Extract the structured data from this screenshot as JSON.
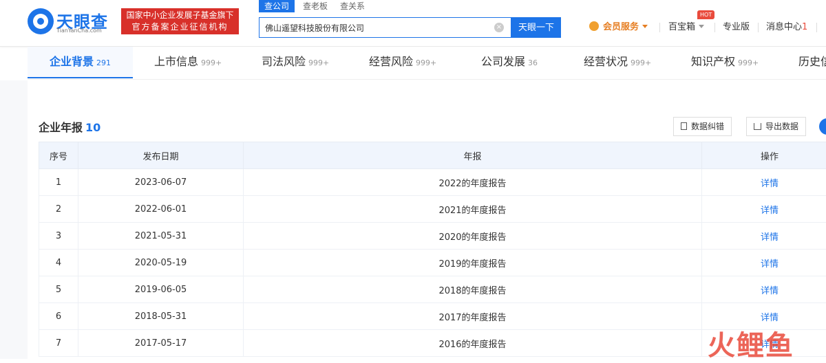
{
  "header": {
    "logo_name": "天眼查",
    "logo_sub": "TianYanCha.com",
    "badge_line1": "国家中小企业发展子基金旗下",
    "badge_line2": "官方备案企业征信机构",
    "search_tabs": [
      "查公司",
      "查老板",
      "查关系"
    ],
    "search_value": "佛山遥望科技股份有限公司",
    "search_button": "天眼一下",
    "vip_label": "会员服务",
    "hot_badge": "HOT",
    "toolbox_label": "百宝箱",
    "pro_label": "专业版",
    "message_label": "消息中心",
    "message_count": "1"
  },
  "tabs": [
    {
      "label": "企业背景",
      "count": "291"
    },
    {
      "label": "上市信息",
      "count": "999+"
    },
    {
      "label": "司法风险",
      "count": "999+"
    },
    {
      "label": "经营风险",
      "count": "999+"
    },
    {
      "label": "公司发展",
      "count": "36"
    },
    {
      "label": "经营状况",
      "count": "999+"
    },
    {
      "label": "知识产权",
      "count": "999+"
    },
    {
      "label": "历史信"
    }
  ],
  "section": {
    "title": "企业年报",
    "count": "10",
    "correct_button": "数据纠错",
    "export_button": "导出数据"
  },
  "table": {
    "headers": [
      "序号",
      "发布日期",
      "年报",
      "操作"
    ],
    "rows": [
      {
        "no": "1",
        "date": "2023-06-07",
        "report": "2022的年度报告",
        "action": "详情"
      },
      {
        "no": "2",
        "date": "2022-06-01",
        "report": "2021的年度报告",
        "action": "详情"
      },
      {
        "no": "3",
        "date": "2021-05-31",
        "report": "2020的年度报告",
        "action": "详情"
      },
      {
        "no": "4",
        "date": "2020-05-19",
        "report": "2019的年度报告",
        "action": "详情"
      },
      {
        "no": "5",
        "date": "2019-06-05",
        "report": "2018的年度报告",
        "action": "详情"
      },
      {
        "no": "6",
        "date": "2018-05-31",
        "report": "2017的年度报告",
        "action": "详情"
      },
      {
        "no": "7",
        "date": "2017-05-17",
        "report": "2016的年度报告",
        "action": "详情"
      }
    ]
  },
  "watermark": "火鲤鱼",
  "colors": {
    "brand": "#1d74e8",
    "badge": "#d8302a",
    "vip": "#e67e22",
    "hot": "#e94b3c"
  }
}
